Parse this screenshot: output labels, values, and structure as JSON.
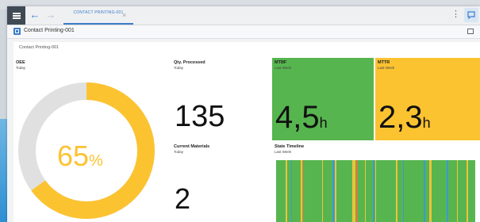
{
  "topbar": {
    "tab_label": "CONTACT PRINTING-001",
    "tab_close": "×",
    "kebab": "⋮"
  },
  "titlebar": {
    "title": "Contact Printing-001"
  },
  "panel": {
    "title": "Contact Printing-001"
  },
  "tiles": {
    "oee": {
      "title": "OEE",
      "subtitle": "Today",
      "value": "65",
      "unit": "%",
      "fraction": 0.65,
      "color": "#fcc331",
      "track_color": "#e0e0e0"
    },
    "qty": {
      "title": "Qty. Processed",
      "subtitle": "Today",
      "value": "135"
    },
    "mtbf": {
      "title": "MTBF",
      "subtitle": "Last Week",
      "value": "4,5",
      "unit": "h",
      "color": "#57b54f"
    },
    "mttr": {
      "title": "MTTR",
      "subtitle": "Last Week",
      "value": "2,3",
      "unit": "h",
      "color": "#fcc331"
    },
    "materials": {
      "title": "Current Materials",
      "subtitle": "Today",
      "value": "2"
    },
    "timeline": {
      "title": "State Timeline",
      "subtitle": "Last Week",
      "base_color": "#57b54f"
    }
  }
}
